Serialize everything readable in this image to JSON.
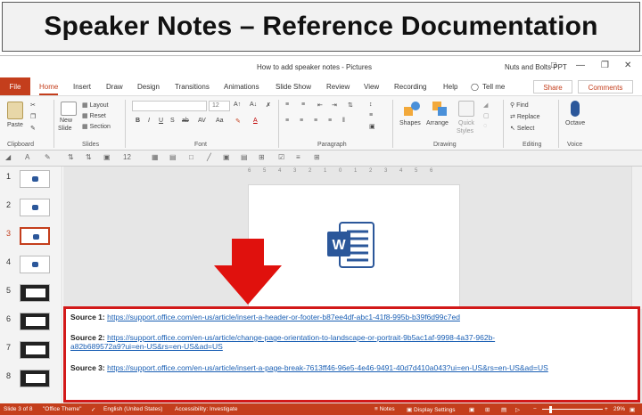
{
  "banner": {
    "title": "Speaker Notes – Reference Documentation"
  },
  "titlebar": {
    "document_title": "How to add speaker notes - Pictures",
    "user": "Nuts and Bolts PPT"
  },
  "tabs": {
    "file": "File",
    "home": "Home",
    "insert": "Insert",
    "draw": "Draw",
    "design": "Design",
    "transitions": "Transitions",
    "animations": "Animations",
    "slideshow": "Slide Show",
    "review": "Review",
    "view": "View",
    "recording": "Recording",
    "help": "Help",
    "tell_me": "Tell me",
    "share": "Share",
    "comments": "Comments"
  },
  "ribbon": {
    "clipboard": {
      "paste": "Paste",
      "group": "Clipboard"
    },
    "slides": {
      "new_slide_1": "New",
      "new_slide_2": "Slide",
      "layout": "Layout",
      "reset": "Reset",
      "section": "Section",
      "group": "Slides"
    },
    "font": {
      "group": "Font",
      "size": "12"
    },
    "paragraph": {
      "group": "Paragraph"
    },
    "drawing": {
      "shapes": "Shapes",
      "arrange": "Arrange",
      "quick_styles_1": "Quick",
      "quick_styles_2": "Styles",
      "group": "Drawing"
    },
    "editing": {
      "find": "Find",
      "replace": "Replace",
      "select": "Select",
      "group": "Editing"
    },
    "voice": {
      "octave": "Octave",
      "group": "Voice"
    }
  },
  "toolbar2": {
    "font_size": "12"
  },
  "ruler": {
    "marks": "6 5 4 3 2 1 0 1 2 3 4 5 6"
  },
  "thumbnails": {
    "n1": "1",
    "n2": "2",
    "n3": "3",
    "n4": "4",
    "n5": "5",
    "n6": "6",
    "n7": "7",
    "n8": "8"
  },
  "notes": {
    "s1_label": "Source 1:",
    "s1_url": "https://support.office.com/en-us/article/insert-a-header-or-footer-b87ee4df-abc1-41f8-995b-b39f6d99c7ed",
    "s2_label": "Source 2:",
    "s2_url_line1": "https://support.office.com/en-us/article/change-page-orientation-to-landscape-or-portrait-9b5ac1af-9998-4a37-962b-",
    "s2_url_line2": "a82b689572a9?ui=en-US&rs=en-US&ad=US",
    "s3_label": "Source 3:",
    "s3_url": "https://support.office.com/en-us/article/insert-a-page-break-7613ff46-96e5-4e46-9491-40d7d410a043?ui=en-US&rs=en-US&ad=US"
  },
  "status": {
    "slide": "Slide 3 of 8",
    "theme": "\"Office Theme\"",
    "language": "English (United States)",
    "accessibility": "Accessibility: Investigate",
    "notes": "Notes",
    "display": "Display Settings",
    "zoom": "29%"
  },
  "colors": {
    "accent": "#c43e1c",
    "highlight_border": "#d21919",
    "link": "#1a5fb4",
    "word_blue": "#2b579a"
  }
}
